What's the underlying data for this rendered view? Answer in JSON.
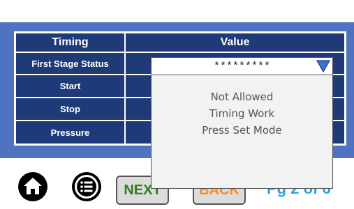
{
  "table": {
    "headers": {
      "col1": "Timing",
      "col2": "Value"
    },
    "rows": [
      {
        "label": "First Stage Status"
      },
      {
        "label": "Start"
      },
      {
        "label": "Stop"
      },
      {
        "label": "Pressure"
      }
    ]
  },
  "dropdown": {
    "masked_value": "*********",
    "message_lines": [
      "Not Allowed",
      "Timing Work",
      "Press Set Mode"
    ],
    "arrow_icon": "triangle-down-icon"
  },
  "nav": {
    "home_icon": "home-icon",
    "menu_icon": "list-menu-icon",
    "next_label": "NEXT",
    "back_label": "BACK",
    "page_indicator": "Pg 2 of 6"
  },
  "colors": {
    "panel_blue": "#4f73c0",
    "table_navy": "#1f3a78",
    "next_green": "#2f7d1c",
    "back_orange": "#ff8a1a",
    "page_blue": "#2aa3e6"
  }
}
